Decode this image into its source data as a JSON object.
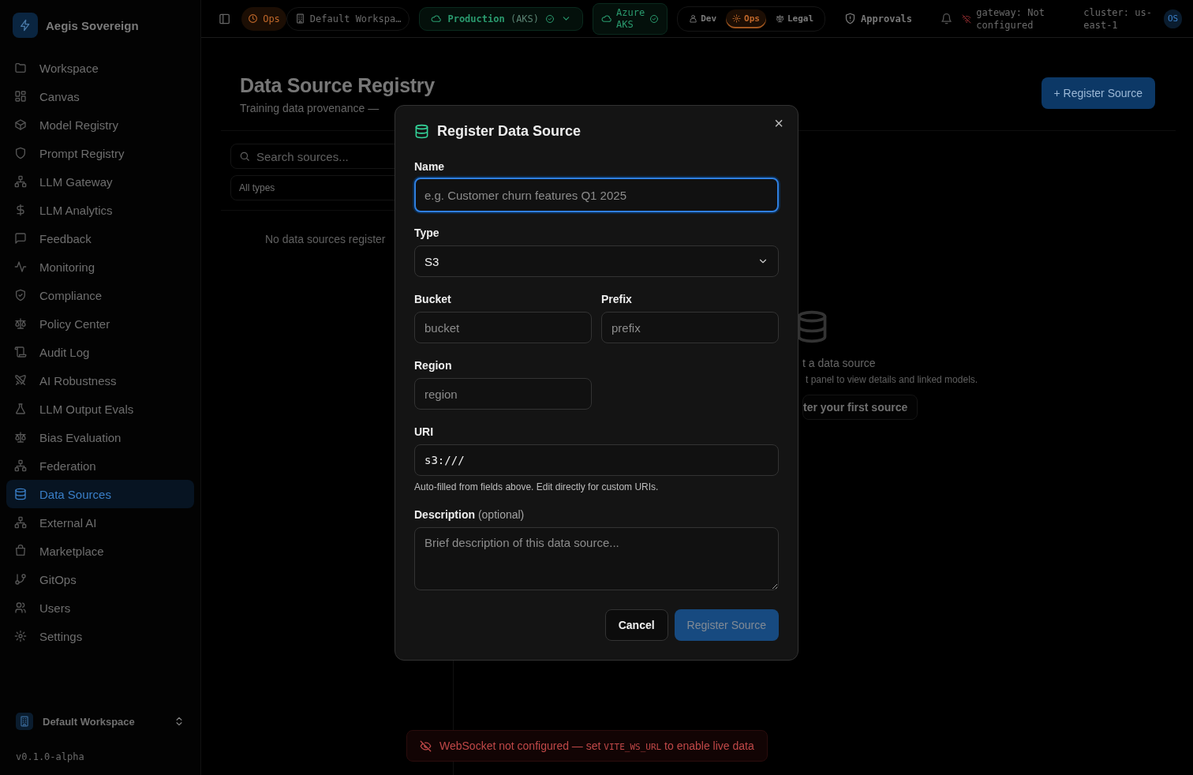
{
  "sidebar": {
    "brand": "Aegis Sovereign",
    "items": [
      {
        "label": "Workspace",
        "selected": false
      },
      {
        "label": "Canvas",
        "selected": false
      },
      {
        "label": "Model Registry",
        "selected": false
      },
      {
        "label": "Prompt Registry",
        "selected": false
      },
      {
        "label": "LLM Gateway",
        "selected": false
      },
      {
        "label": "LLM Analytics",
        "selected": false
      },
      {
        "label": "Feedback",
        "selected": false
      },
      {
        "label": "Monitoring",
        "selected": false
      },
      {
        "label": "Compliance",
        "selected": false
      },
      {
        "label": "Policy Center",
        "selected": false
      },
      {
        "label": "Audit Log",
        "selected": false
      },
      {
        "label": "AI Robustness",
        "selected": false
      },
      {
        "label": "LLM Output Evals",
        "selected": false
      },
      {
        "label": "Bias Evaluation",
        "selected": false
      },
      {
        "label": "Federation",
        "selected": false
      },
      {
        "label": "Data Sources",
        "selected": true
      },
      {
        "label": "External AI",
        "selected": false
      },
      {
        "label": "Marketplace",
        "selected": false
      },
      {
        "label": "GitOps",
        "selected": false
      },
      {
        "label": "Users",
        "selected": false
      },
      {
        "label": "Settings",
        "selected": false
      }
    ],
    "workspace": "Default Workspace",
    "version": "v0.1.0-alpha"
  },
  "topbar": {
    "env_chip": "Ops",
    "workspace_chip": "Default Workspa…",
    "cluster_chip": {
      "label": "Production",
      "suffix": "(AKS)"
    },
    "provider_chip": "Azure AKS",
    "personas": [
      {
        "label": "Dev",
        "selected": false
      },
      {
        "label": "Ops",
        "selected": true
      },
      {
        "label": "Legal",
        "selected": false
      }
    ],
    "approvals": "Approvals",
    "gateway_status": "gateway: Not configured",
    "cluster_status": "cluster: us-east-1",
    "avatar": "OS"
  },
  "page": {
    "title": "Data Source Registry",
    "subtitle": "Training data provenance —",
    "register_button": "+ Register Source",
    "search": {
      "placeholder": "Search sources..."
    },
    "type_filter": "All types",
    "empty_list": "No data sources register",
    "detail": {
      "title": "t a data source",
      "text": "t panel to view details and linked models.",
      "button": "ter your first source"
    }
  },
  "modal": {
    "title": "Register Data Source",
    "close": "×",
    "fields": [
      {
        "label": "Name",
        "kind": "input",
        "wide": true,
        "focused": true,
        "placeholder": "e.g. Customer churn features Q1 2025"
      },
      {
        "label": "Type",
        "kind": "select",
        "wide": true,
        "focused": false,
        "value": "S3"
      },
      {
        "label": "Bucket",
        "kind": "input",
        "wide": false,
        "focused": false,
        "placeholder": "bucket"
      },
      {
        "label": "Prefix",
        "kind": "input",
        "wide": false,
        "focused": false,
        "placeholder": "prefix"
      },
      {
        "label": "Region",
        "kind": "input",
        "wide": false,
        "focused": false,
        "placeholder": "region"
      },
      {
        "label": "URI",
        "kind": "code",
        "wide": true,
        "focused": false,
        "value": "s3:///",
        "hint": "Auto-filled from fields above. Edit directly for custom URIs."
      },
      {
        "label": "Description",
        "note": "(optional)",
        "kind": "textarea",
        "wide": true,
        "focused": false,
        "placeholder": "Brief description of this data source..."
      }
    ],
    "buttons": [
      {
        "label": "Cancel",
        "kind": "secondary",
        "disabled": false
      },
      {
        "label": "Register Source",
        "kind": "primary",
        "disabled": true
      }
    ]
  },
  "toast": {
    "before": "WebSocket not configured — set ",
    "code": "VITE_WS_URL",
    "after": " to enable live data"
  }
}
